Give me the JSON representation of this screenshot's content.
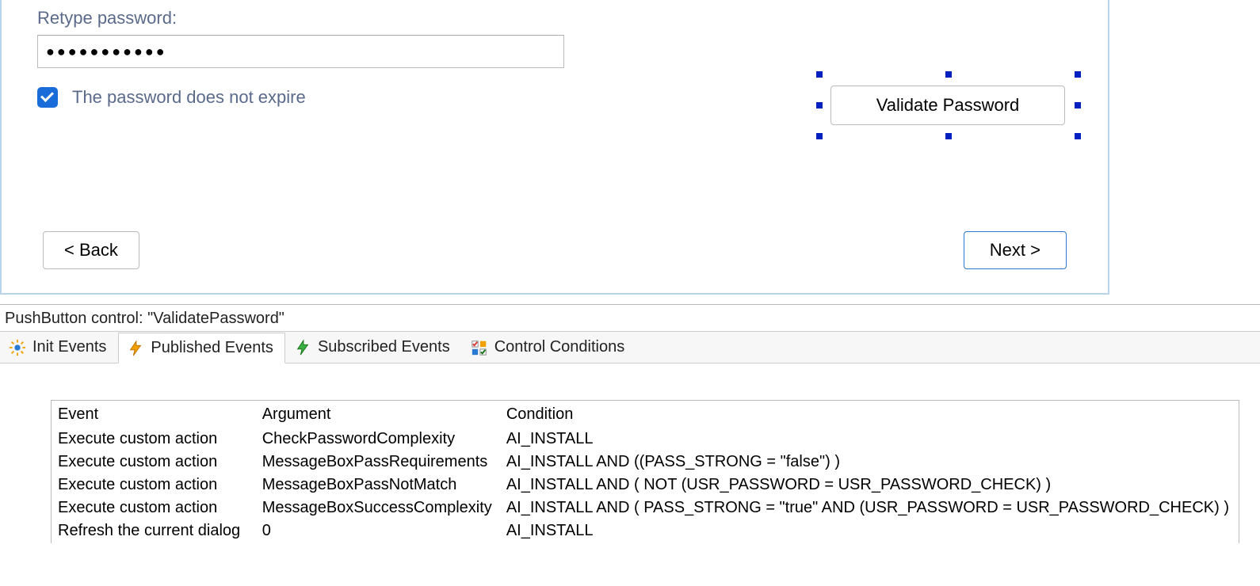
{
  "dialog": {
    "retype_label": "Retype password:",
    "password_mask": "●●●●●●●●●●●",
    "checkbox_label": "The password does not expire",
    "validate_label": "Validate Password",
    "back_label": "< Back",
    "next_label": "Next >"
  },
  "panel": {
    "title": "PushButton control: \"ValidatePassword\""
  },
  "tabs": {
    "init": "Init Events",
    "published": "Published Events",
    "subscribed": "Subscribed Events",
    "conditions": "Control Conditions"
  },
  "table": {
    "headers": {
      "event": "Event",
      "argument": "Argument",
      "condition": "Condition"
    },
    "rows": [
      {
        "event": "Execute custom action",
        "argument": "CheckPasswordComplexity",
        "condition": "AI_INSTALL"
      },
      {
        "event": "Execute custom action",
        "argument": "MessageBoxPassRequirements",
        "condition": "AI_INSTALL AND ((PASS_STRONG = \"false\") )"
      },
      {
        "event": "Execute custom action",
        "argument": "MessageBoxPassNotMatch",
        "condition": "AI_INSTALL AND ( NOT (USR_PASSWORD = USR_PASSWORD_CHECK) )"
      },
      {
        "event": "Execute custom action",
        "argument": "MessageBoxSuccessComplexity",
        "condition": "AI_INSTALL AND ( PASS_STRONG = \"true\" AND (USR_PASSWORD = USR_PASSWORD_CHECK) )"
      },
      {
        "event": "Refresh the current dialog",
        "argument": "0",
        "condition": "AI_INSTALL"
      }
    ]
  }
}
